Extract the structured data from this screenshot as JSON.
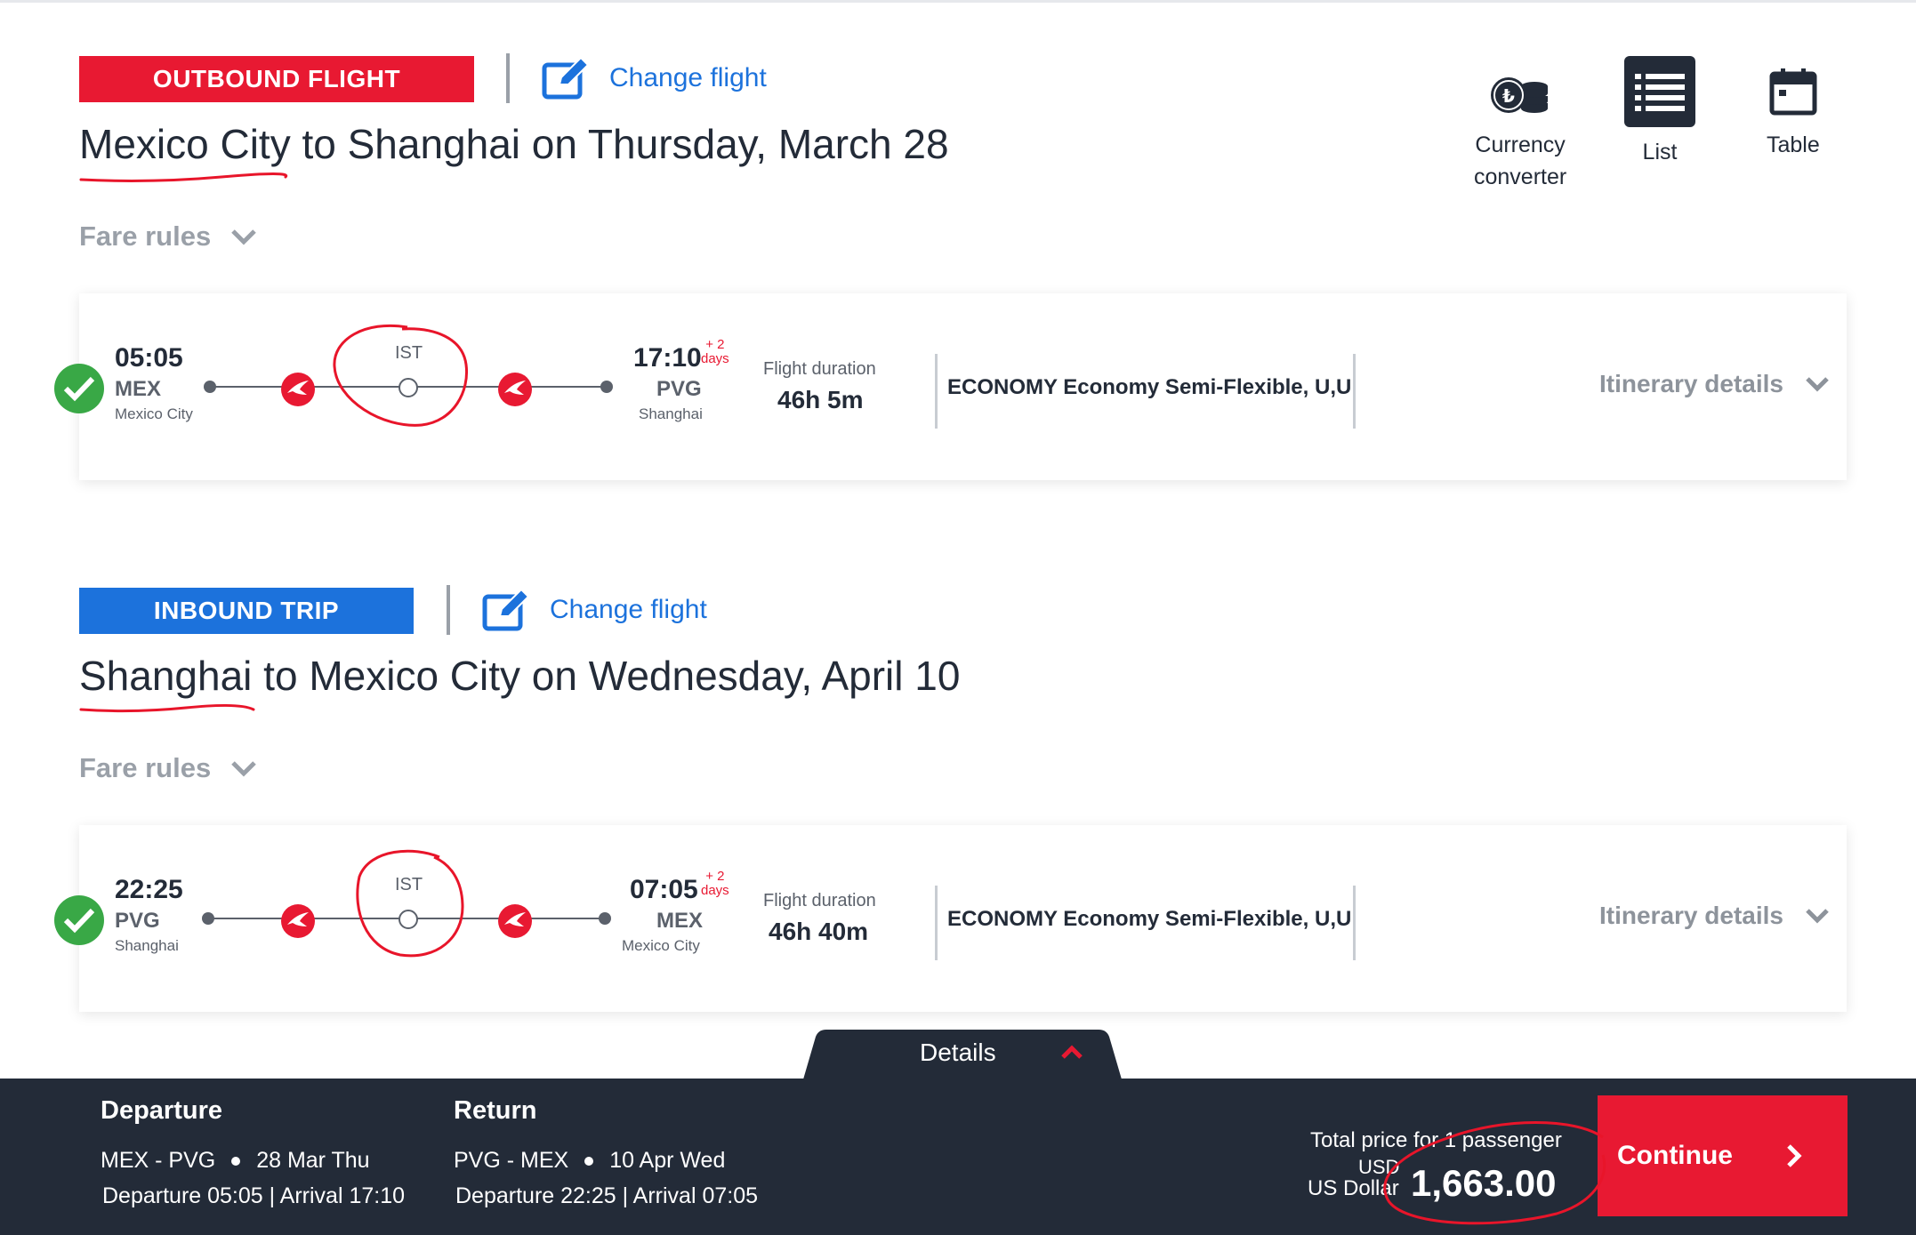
{
  "views": {
    "currency_label_1": "Currency",
    "currency_label_2": "converter",
    "list_label": "List",
    "table_label": "Table"
  },
  "outbound": {
    "badge": "OUTBOUND FLIGHT",
    "change_flight": "Change flight",
    "route_title": "Mexico City to Shanghai on Thursday, March 28",
    "fare_rules": "Fare rules",
    "dep_time": "05:05",
    "dep_code": "MEX",
    "dep_city": "Mexico City",
    "stop_code": "IST",
    "arr_time": "17:10",
    "plus_days_top": "+ 2",
    "plus_days_bottom": "days",
    "arr_code": "PVG",
    "arr_city": "Shanghai",
    "duration_label": "Flight duration",
    "duration": "46h 5m",
    "cabin": "ECONOMY Economy Semi-Flexible, U,U",
    "itinerary": "Itinerary details"
  },
  "inbound": {
    "badge": "INBOUND TRIP",
    "change_flight": "Change flight",
    "route_title": "Shanghai to Mexico City on Wednesday, April 10",
    "fare_rules": "Fare rules",
    "dep_time": "22:25",
    "dep_code": "PVG",
    "dep_city": "Shanghai",
    "stop_code": "IST",
    "arr_time": "07:05",
    "plus_days_top": "+ 2",
    "plus_days_bottom": "days",
    "arr_code": "MEX",
    "arr_city": "Mexico City",
    "duration_label": "Flight duration",
    "duration": "46h 40m",
    "cabin": "ECONOMY Economy Semi-Flexible, U,U",
    "itinerary": "Itinerary details"
  },
  "details_tab": "Details",
  "footer": {
    "departure_head": "Departure",
    "departure_route_from": "MEX - PVG",
    "departure_route_date": "28 Mar Thu",
    "departure_times": "Departure 05:05 | Arrival 17:10",
    "return_head": "Return",
    "return_route_from": "PVG - MEX",
    "return_route_date": "10 Apr Wed",
    "return_times": "Departure 22:25 | Arrival 07:05",
    "total_label": "Total price for 1 passenger",
    "currency_code": "USD",
    "currency_name": "US Dollar",
    "price": "1,663.00",
    "continue": "Continue"
  },
  "colors": {
    "brand_red": "#e81932",
    "brand_blue": "#1c72dc",
    "dark_navy": "#232b38",
    "success_green": "#39a846",
    "annotation_red": "#e8152a"
  }
}
